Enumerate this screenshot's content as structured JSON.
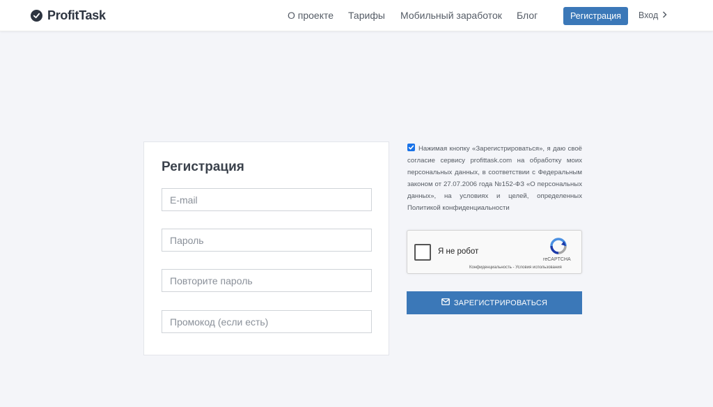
{
  "header": {
    "logo_text": "ProfitTask",
    "nav": [
      {
        "label": "О проекте"
      },
      {
        "label": "Тарифы"
      },
      {
        "label": "Мобильный заработок"
      },
      {
        "label": "Блог"
      }
    ],
    "register_label": "Регистрация",
    "login_label": "Вход"
  },
  "form": {
    "title": "Регистрация",
    "email_placeholder": "E-mail",
    "password_placeholder": "Пароль",
    "repeat_password_placeholder": "Повторите пароль",
    "promo_placeholder": "Промокод (если есть)"
  },
  "consent": {
    "checked": true,
    "text": "Нажимая кнопку «Зарегистрироваться», я даю своё согласие сервису profittask.com на обработку моих персональных данных, в соответствии с Федеральным законом от 27.07.2006 года №152-ФЗ «О персональных данных», на условиях и целей, определенных Политикой конфиденциальности"
  },
  "captcha": {
    "label": "Я не робот",
    "brand": "reCAPTCHA",
    "links": "Конфиденциальность - Условия использования"
  },
  "submit": {
    "label": "ЗАРЕГИСТРИРОВАТЬСЯ",
    "icon": "envelope-icon"
  },
  "colors": {
    "accent": "#3b78b8",
    "background": "#f4f5f9",
    "logo": "#2d3440"
  }
}
